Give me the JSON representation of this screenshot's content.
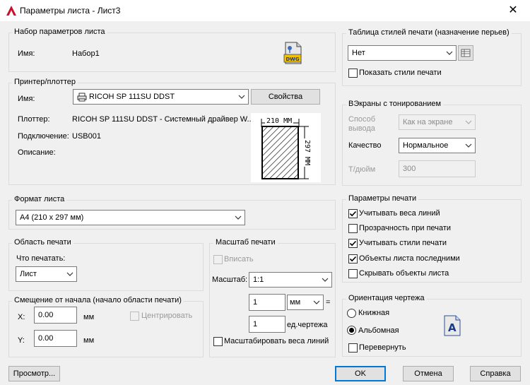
{
  "window": {
    "title": "Параметры листа - Лист3",
    "close_glyph": "✕"
  },
  "page_setup": {
    "group_title": "Набор параметров листа",
    "name_label": "Имя:",
    "name_value": "Набор1",
    "file_icon_text": "DWG"
  },
  "printer": {
    "group_title": "Принтер/плоттер",
    "name_label": "Имя:",
    "name_value": "RICOH SP 111SU DDST",
    "properties_button": "Свойства",
    "plotter_label": "Плоттер:",
    "plotter_value": "RICOH SP 111SU DDST - Системный драйвер W...",
    "connection_label": "Подключение:",
    "connection_value": "USB001",
    "description_label": "Описание:",
    "preview_width": "210 MM",
    "preview_height": "297 MM"
  },
  "paper": {
    "group_title": "Формат листа",
    "value": "A4 (210 x 297 мм)"
  },
  "print_area": {
    "group_title": "Область печати",
    "what_label": "Что печатать:",
    "what_value": "Лист"
  },
  "offset": {
    "group_title": "Смещение от начала (начало области печати)",
    "x_label": "X:",
    "x_value": "0.00",
    "x_unit": "мм",
    "y_label": "Y:",
    "y_value": "0.00",
    "y_unit": "мм",
    "center_label": "Центрировать"
  },
  "scale": {
    "group_title": "Масштаб печати",
    "fit_label": "Вписать",
    "scale_label": "Масштаб:",
    "scale_value": "1:1",
    "value1": "1",
    "unit1": "мм",
    "equals": "=",
    "value2": "1",
    "unit2": "ед.чертежа",
    "lineweights_label": "Масштабировать веса линий"
  },
  "plot_style": {
    "group_title": "Таблица стилей печати (назначение перьев)",
    "value": "Нет",
    "show_label": "Показать стили печати"
  },
  "shaded": {
    "group_title": "ВЭкраны с тонированием",
    "output_label_1": "Способ",
    "output_label_2": "вывода",
    "output_value": "Как на экране",
    "quality_label": "Качество",
    "quality_value": "Нормальное",
    "dpi_label": "Т/дюйм",
    "dpi_value": "300"
  },
  "options": {
    "group_title": "Параметры печати",
    "items": [
      {
        "label": "Учитывать веса линий",
        "checked": true
      },
      {
        "label": "Прозрачность при печати",
        "checked": false
      },
      {
        "label": "Учитывать стили печати",
        "checked": true
      },
      {
        "label": "Объекты листа последними",
        "checked": true
      },
      {
        "label": "Скрывать объекты листа",
        "checked": false
      }
    ]
  },
  "orientation": {
    "group_title": "Ориентация чертежа",
    "portrait": "Книжная",
    "landscape": "Альбомная",
    "upside_down": "Перевернуть",
    "selected": "landscape",
    "icon_letter": "A"
  },
  "footer": {
    "preview": "Просмотр...",
    "ok": "OK",
    "cancel": "Отмена",
    "help": "Справка"
  }
}
